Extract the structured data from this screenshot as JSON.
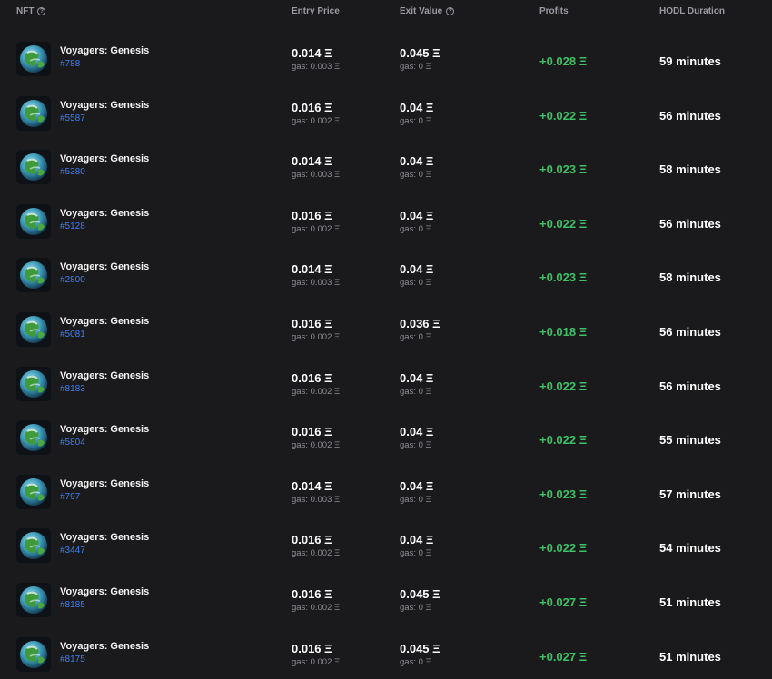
{
  "header": {
    "nft": "NFT",
    "entry_price": "Entry Price",
    "exit_value": "Exit Value",
    "profits": "Profits",
    "hodl": "HODL Duration",
    "info_icon": "?"
  },
  "rows": [
    {
      "name": "Voyagers: Genesis",
      "id": "#788",
      "entry": "0.014 Ξ",
      "entry_gas": "gas: 0.003 Ξ",
      "exit": "0.045 Ξ",
      "exit_gas": "gas: 0 Ξ",
      "profit": "+0.028 Ξ",
      "hodl": "59 minutes"
    },
    {
      "name": "Voyagers: Genesis",
      "id": "#5587",
      "entry": "0.016 Ξ",
      "entry_gas": "gas: 0.002 Ξ",
      "exit": "0.04 Ξ",
      "exit_gas": "gas: 0 Ξ",
      "profit": "+0.022 Ξ",
      "hodl": "56 minutes"
    },
    {
      "name": "Voyagers: Genesis",
      "id": "#5380",
      "entry": "0.014 Ξ",
      "entry_gas": "gas: 0.003 Ξ",
      "exit": "0.04 Ξ",
      "exit_gas": "gas: 0 Ξ",
      "profit": "+0.023 Ξ",
      "hodl": "58 minutes"
    },
    {
      "name": "Voyagers: Genesis",
      "id": "#5128",
      "entry": "0.016 Ξ",
      "entry_gas": "gas: 0.002 Ξ",
      "exit": "0.04 Ξ",
      "exit_gas": "gas: 0 Ξ",
      "profit": "+0.022 Ξ",
      "hodl": "56 minutes"
    },
    {
      "name": "Voyagers: Genesis",
      "id": "#2800",
      "entry": "0.014 Ξ",
      "entry_gas": "gas: 0.003 Ξ",
      "exit": "0.04 Ξ",
      "exit_gas": "gas: 0 Ξ",
      "profit": "+0.023 Ξ",
      "hodl": "58 minutes"
    },
    {
      "name": "Voyagers: Genesis",
      "id": "#5081",
      "entry": "0.016 Ξ",
      "entry_gas": "gas: 0.002 Ξ",
      "exit": "0.036 Ξ",
      "exit_gas": "gas: 0 Ξ",
      "profit": "+0.018 Ξ",
      "hodl": "56 minutes"
    },
    {
      "name": "Voyagers: Genesis",
      "id": "#8183",
      "entry": "0.016 Ξ",
      "entry_gas": "gas: 0.002 Ξ",
      "exit": "0.04 Ξ",
      "exit_gas": "gas: 0 Ξ",
      "profit": "+0.022 Ξ",
      "hodl": "56 minutes"
    },
    {
      "name": "Voyagers: Genesis",
      "id": "#5804",
      "entry": "0.016 Ξ",
      "entry_gas": "gas: 0.002 Ξ",
      "exit": "0.04 Ξ",
      "exit_gas": "gas: 0 Ξ",
      "profit": "+0.022 Ξ",
      "hodl": "55 minutes"
    },
    {
      "name": "Voyagers: Genesis",
      "id": "#797",
      "entry": "0.014 Ξ",
      "entry_gas": "gas: 0.003 Ξ",
      "exit": "0.04 Ξ",
      "exit_gas": "gas: 0 Ξ",
      "profit": "+0.023 Ξ",
      "hodl": "57 minutes"
    },
    {
      "name": "Voyagers: Genesis",
      "id": "#3447",
      "entry": "0.016 Ξ",
      "entry_gas": "gas: 0.002 Ξ",
      "exit": "0.04 Ξ",
      "exit_gas": "gas: 0 Ξ",
      "profit": "+0.022 Ξ",
      "hodl": "54 minutes"
    },
    {
      "name": "Voyagers: Genesis",
      "id": "#8185",
      "entry": "0.016 Ξ",
      "entry_gas": "gas: 0.002 Ξ",
      "exit": "0.045 Ξ",
      "exit_gas": "gas: 0 Ξ",
      "profit": "+0.027 Ξ",
      "hodl": "51 minutes"
    },
    {
      "name": "Voyagers: Genesis",
      "id": "#8175",
      "entry": "0.016 Ξ",
      "entry_gas": "gas: 0.002 Ξ",
      "exit": "0.045 Ξ",
      "exit_gas": "gas: 0 Ξ",
      "profit": "+0.027 Ξ",
      "hodl": "51 minutes"
    }
  ],
  "colors": {
    "profit": "#3fbf68",
    "link": "#3f7ff2",
    "background": "#1a1a1c"
  },
  "icons": {
    "thumbnail": "planet-icon",
    "info": "info-icon"
  }
}
